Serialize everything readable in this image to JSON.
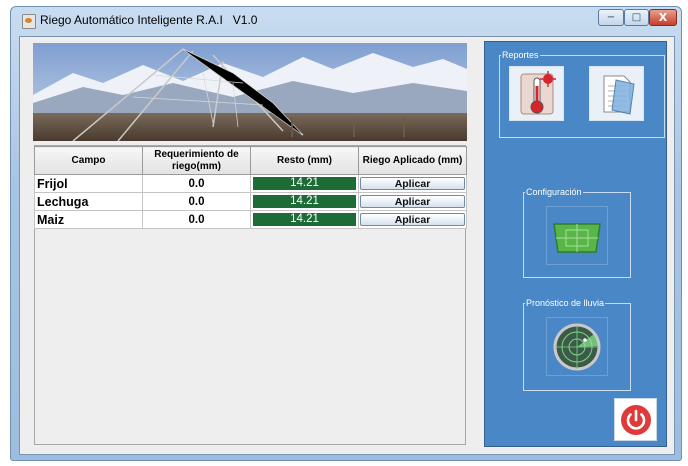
{
  "window": {
    "title": "Riego Automático Inteligente R.A.I   V1.0",
    "controls": {
      "minimize": "−",
      "maximize": "□",
      "close": "X"
    }
  },
  "table": {
    "columns": [
      "Campo",
      "Requerimiento de riego(mm)",
      "Resto (mm)",
      "Riego Aplicado (mm)"
    ],
    "rows": [
      {
        "campo": "Frijol",
        "requerimiento": "0.0",
        "resto": "14.21",
        "action": "Aplicar"
      },
      {
        "campo": "Lechuga",
        "requerimiento": "0.0",
        "resto": "14.21",
        "action": "Aplicar"
      },
      {
        "campo": "Maiz",
        "requerimiento": "0.0",
        "resto": "14.21",
        "action": "Aplicar"
      }
    ]
  },
  "side_panel": {
    "reportes_label": "Reportes",
    "configuracion_label": "Configuración",
    "pronostico_label": "Pronóstico de lluvia"
  },
  "icons": {
    "app": "java-app-icon",
    "banner": "irrigation-field-photo",
    "report_temperature": "thermometer-icon",
    "report_documents": "documents-folder-icon",
    "configuracion": "field-map-icon",
    "pronostico": "radar-icon",
    "power": "power-icon"
  },
  "colors": {
    "panel_blue": "#4a87c6",
    "resto_green": "#1d6b36",
    "power_red": "#e0393a"
  }
}
